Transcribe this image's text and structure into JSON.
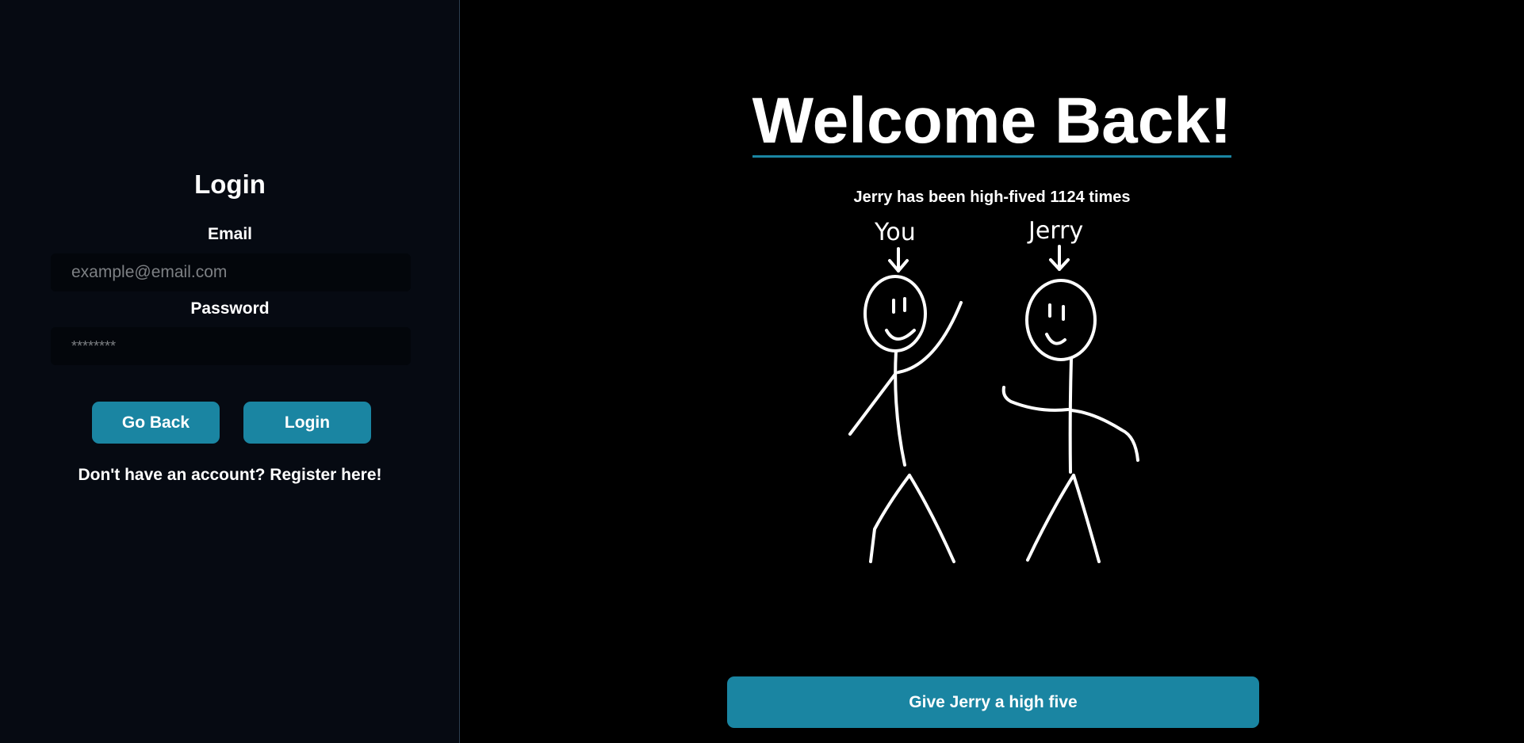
{
  "sidebar": {
    "title": "Login",
    "email_label": "Email",
    "email_placeholder": "example@email.com",
    "email_value": "",
    "password_label": "Password",
    "password_placeholder": "********",
    "password_value": "",
    "go_back_label": "Go Back",
    "login_label": "Login",
    "register_text": "Don't have an account? Register here!"
  },
  "main": {
    "title": "Welcome Back!",
    "counter_prefix": "Jerry has been high-fived",
    "counter_value": "1124",
    "counter_suffix": "times",
    "drawing": {
      "you_label": "You",
      "jerry_label": "Jerry"
    },
    "high_five_label": "Give Jerry a high five"
  },
  "colors": {
    "accent": "#1a85a2",
    "sidebar_bg": "#060a12",
    "main_bg": "#000000",
    "input_bg": "#03060b",
    "text": "#ffffff"
  }
}
